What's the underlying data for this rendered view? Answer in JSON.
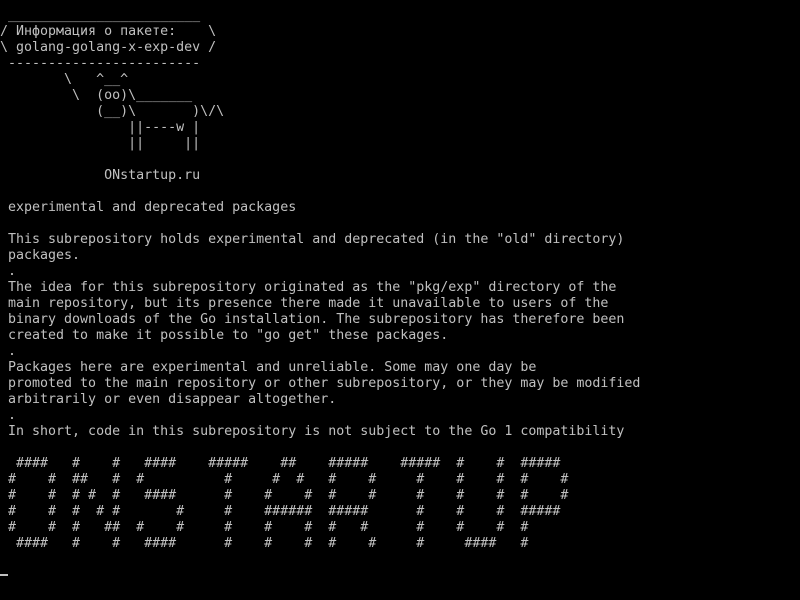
{
  "colors": {
    "background": "#000000",
    "foreground": "#c0c0c0"
  },
  "lines": [
    " ________________________",
    "/ Информация о пакете:    \\",
    "\\ golang-golang-x-exp-dev /",
    " ------------------------",
    "        \\   ^__^",
    "         \\  (oo)\\_______",
    "            (__)\\       )\\/\\",
    "                ||----w |",
    "                ||     ||",
    "",
    "             ONstartup.ru",
    "",
    " experimental and deprecated packages",
    "",
    " This subrepository holds experimental and deprecated (in the \"old\" directory)",
    " packages.",
    " .",
    " The idea for this subrepository originated as the \"pkg/exp\" directory of the",
    " main repository, but its presence there made it unavailable to users of the",
    " binary downloads of the Go installation. The subrepository has therefore been",
    " created to make it possible to \"go get\" these packages.",
    " .",
    " Packages here are experimental and unreliable. Some may one day be",
    " promoted to the main repository or other subrepository, or they may be modified",
    " arbitrarily or even disappear altogether.",
    " .",
    " In short, code in this subrepository is not subject to the Go 1 compatibility",
    "",
    "  ####   #    #   ####    #####    ##    #####    #####  #    #  #####",
    " #    #  ##   #  #          #     #  #   #    #     #    #    #  #    #",
    " #    #  # #  #   ####      #    #    #  #    #     #    #    #  #    #",
    " #    #  #  # #       #     #    ######  #####      #    #    #  #####",
    " #    #  #   ##  #    #     #    #    #  #   #      #    #    #  #",
    "  ####   #    #   ####      #    #    #  #    #     #     ####   #"
  ]
}
